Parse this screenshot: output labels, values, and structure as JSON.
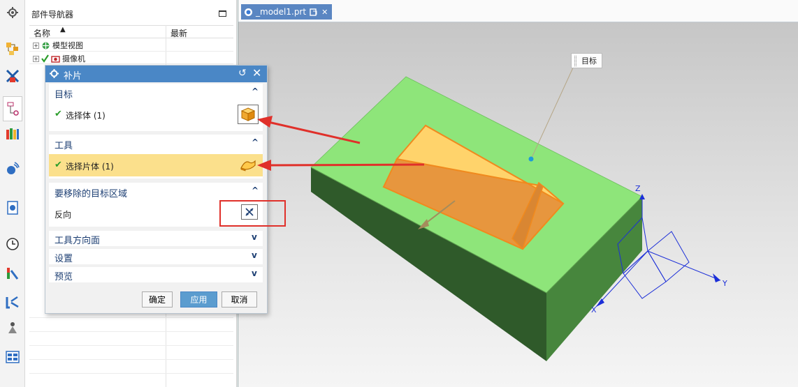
{
  "navigator": {
    "title": "部件导航器",
    "columns": {
      "name": "名称",
      "latest": "最新"
    },
    "tree": [
      {
        "label": "模型视图"
      },
      {
        "label": "摄像机"
      }
    ]
  },
  "tab": {
    "label": "_model1.prt"
  },
  "graphics": {
    "target_callout": "目标"
  },
  "axes": {
    "x": "X",
    "y": "Y",
    "z": "Z"
  },
  "dialog": {
    "title": "补片",
    "sections": {
      "target": {
        "title": "目标",
        "row_label": "选择体 (1)"
      },
      "tool": {
        "title": "工具",
        "row_label": "选择片体 (1)"
      },
      "region": {
        "title": "要移除的目标区域",
        "row_label": "反向"
      },
      "tool_dir": {
        "title": "工具方向面"
      },
      "settings": {
        "title": "设置"
      },
      "preview": {
        "title": "预览"
      }
    },
    "buttons": {
      "ok": "确定",
      "apply": "应用",
      "cancel": "取消"
    }
  },
  "colors": {
    "dialog_title": "#4a87c6",
    "selected_row": "#fbe08c",
    "block_top": "#8ee57a",
    "tool_face": "#ffd36b",
    "annotation": "#e0302a"
  }
}
